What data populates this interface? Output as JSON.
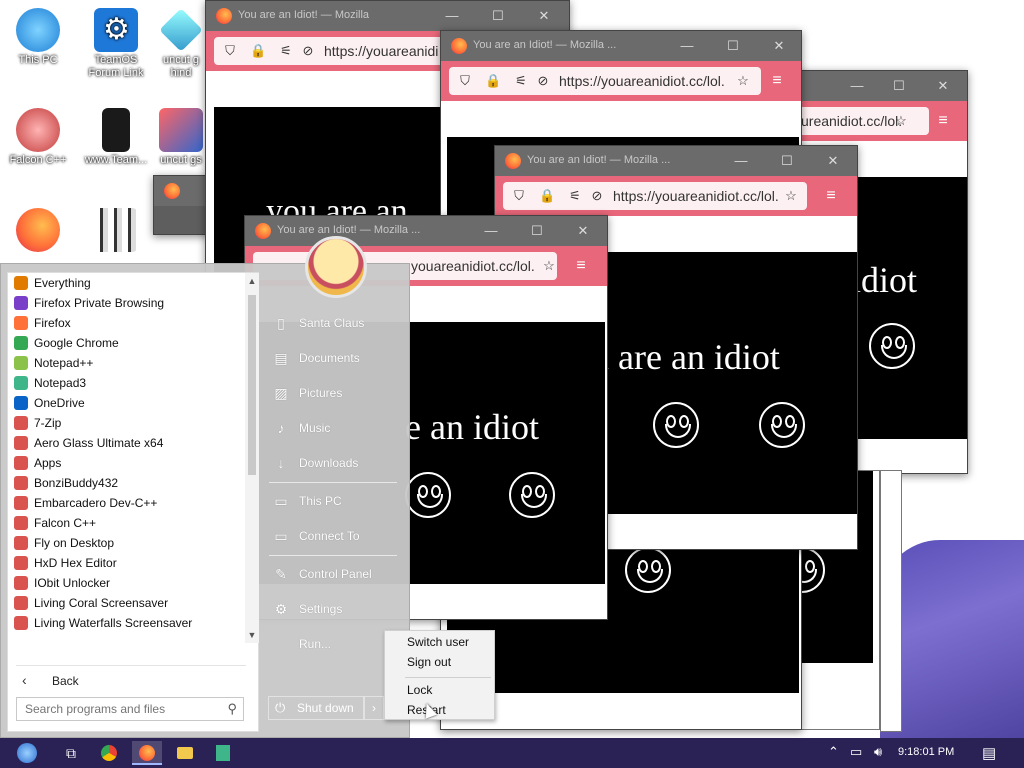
{
  "desktop": {
    "icons": [
      {
        "label": "This PC"
      },
      {
        "label": "TeamOS Forum Link"
      },
      {
        "label": "uncut g hind"
      },
      {
        "label": "Falcon C++"
      },
      {
        "label": "www.Team..."
      },
      {
        "label": "uncut gs"
      }
    ]
  },
  "windows": [
    {
      "title": "You are an Idiot! — Mozilla",
      "url": "https://youareanidi"
    },
    {
      "title": "You are an Idiot! — Mozilla ...",
      "url": "https://youareanidiot.cc/lol."
    },
    {
      "title": "",
      "url": "ureanidiot.cc/lol."
    },
    {
      "title": "You are an Idiot! — Mozilla ...",
      "url": "https://youareanidiot.cc/lol."
    },
    {
      "title": "You are an Idiot! — Mozilla ...",
      "url": "youareanidiot.cc/lol."
    }
  ],
  "page_text": {
    "w1": "you are an",
    "w3": "idiot",
    "w4": "u are an idiot",
    "w5": "e an idiot"
  },
  "start_menu": {
    "programs": [
      {
        "label": "Everything",
        "color": "#e07b00"
      },
      {
        "label": "Firefox Private Browsing",
        "color": "#7a3fc9"
      },
      {
        "label": "Firefox",
        "color": "#ff7139"
      },
      {
        "label": "Google Chrome",
        "color": "#34a853"
      },
      {
        "label": "Notepad++",
        "color": "#8bc34a"
      },
      {
        "label": "Notepad3",
        "color": "#3fb58a"
      },
      {
        "label": "OneDrive",
        "color": "#0a64c8"
      },
      {
        "label": "7-Zip",
        "color": "#d9534f"
      },
      {
        "label": "Aero Glass Ultimate x64",
        "color": "#d9534f"
      },
      {
        "label": "Apps",
        "color": "#d9534f"
      },
      {
        "label": "BonziBuddy432",
        "color": "#d9534f"
      },
      {
        "label": "Embarcadero Dev-C++",
        "color": "#d9534f"
      },
      {
        "label": "Falcon C++",
        "color": "#d9534f"
      },
      {
        "label": "Fly on Desktop",
        "color": "#d9534f"
      },
      {
        "label": "HxD Hex Editor",
        "color": "#d9534f"
      },
      {
        "label": "IObit Unlocker",
        "color": "#d9534f"
      },
      {
        "label": "Living Coral Screensaver",
        "color": "#d9534f"
      },
      {
        "label": "Living Waterfalls Screensaver",
        "color": "#d9534f"
      }
    ],
    "back_label": "Back",
    "search_placeholder": "Search programs and files",
    "places": [
      {
        "label": "Santa Claus",
        "icon": "folder-user-icon"
      },
      {
        "label": "Documents",
        "icon": "document-icon"
      },
      {
        "label": "Pictures",
        "icon": "picture-icon"
      },
      {
        "label": "Music",
        "icon": "music-note-icon"
      },
      {
        "label": "Downloads",
        "icon": "download-icon"
      },
      {
        "label": "This PC",
        "icon": "computer-icon"
      },
      {
        "label": "Connect To",
        "icon": "network-icon"
      },
      {
        "label": "Control Panel",
        "icon": "wrench-icon"
      },
      {
        "label": "Settings",
        "icon": "gear-icon"
      },
      {
        "label": "Run...",
        "icon": "run-icon"
      }
    ],
    "shutdown_label": "Shut down"
  },
  "power_menu": {
    "items": [
      "Switch user",
      "Sign out",
      "Lock",
      "Restart"
    ]
  },
  "taskbar": {
    "clock": "9:18:01 PM"
  }
}
